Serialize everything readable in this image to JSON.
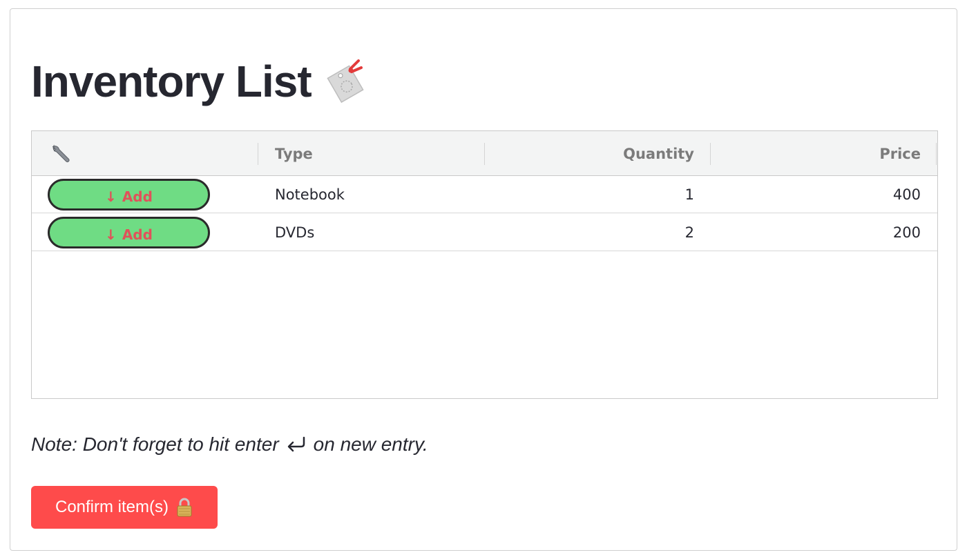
{
  "page": {
    "title": "Inventory List",
    "title_icon": "price-tag-icon"
  },
  "table": {
    "action_column_icon": "wrench-icon",
    "columns": [
      "Type",
      "Quantity",
      "Price"
    ],
    "rows": [
      {
        "action_label": "Add",
        "action_icon": "down-arrow-icon",
        "type": "Notebook",
        "quantity": "1",
        "price": "400"
      },
      {
        "action_label": "Add",
        "action_icon": "down-arrow-icon",
        "type": "DVDs",
        "quantity": "2",
        "price": "200"
      }
    ]
  },
  "note": {
    "before": "Note: Don't forget to hit enter",
    "icon": "enter-return-icon",
    "after": "on new entry."
  },
  "confirm_button": {
    "label": "Confirm item(s)",
    "icon": "lock-icon"
  },
  "colors": {
    "text": "#262730",
    "add_button_bg": "#6fdc84",
    "add_button_text": "#e0525a",
    "confirm_button_bg": "#fe4b4b",
    "header_bg": "#f3f4f4",
    "header_text": "#7b7b7b"
  }
}
